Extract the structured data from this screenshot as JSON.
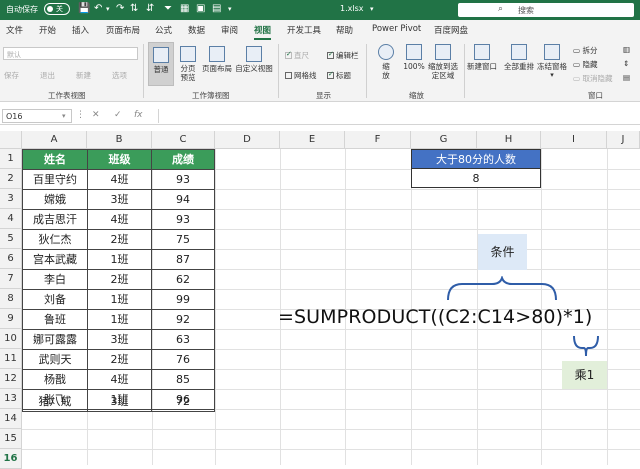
{
  "titlebar": {
    "autosave_label": "自动保存",
    "autosave_state": "关",
    "filename": "1.xlsx",
    "search_placeholder": "搜索",
    "accent": "#217346"
  },
  "tabs": [
    "文件",
    "开始",
    "插入",
    "页面布局",
    "公式",
    "数据",
    "审阅",
    "视图",
    "开发工具",
    "帮助",
    "Power Pivot",
    "百度网盘"
  ],
  "active_tab": "视图",
  "ribbon": {
    "sheetview": {
      "dropdown": "默认",
      "keep": "保存",
      "exit": "退出",
      "new": "新建",
      "options": "选项",
      "label": "工作表视图"
    },
    "workbookview": {
      "normal": "普通",
      "pagebreak": "分页预览",
      "pagelayout": "页面布局",
      "custom": "自定义视图",
      "label": "工作簿视图"
    },
    "show": {
      "ruler": "直尺",
      "formulabar": "编辑栏",
      "gridlines": "网格线",
      "headings": "标题",
      "label": "显示"
    },
    "zoom": {
      "zoom": "缩放",
      "hundred": "100%",
      "toselection": "缩放到选定区域",
      "label": "缩放"
    },
    "window": {
      "newwindow": "新建窗口",
      "arrange": "全部重排",
      "freeze": "冻结窗格",
      "split": "拆分",
      "hide": "隐藏",
      "unhide": "取消隐藏",
      "label": "窗口"
    }
  },
  "formula_bar": {
    "namebox": "O16",
    "fx": "fx"
  },
  "columns": [
    "A",
    "B",
    "C",
    "D",
    "E",
    "F",
    "G",
    "H",
    "I",
    "J"
  ],
  "rows": [
    "1",
    "2",
    "3",
    "4",
    "5",
    "6",
    "7",
    "8",
    "9",
    "10",
    "11",
    "12",
    "13",
    "14",
    "15",
    "16"
  ],
  "table": {
    "headers": [
      "姓名",
      "班级",
      "成绩"
    ],
    "rows": [
      [
        "百里守约",
        "4班",
        "93"
      ],
      [
        "嫦娥",
        "3班",
        "94"
      ],
      [
        "成吉思汗",
        "4班",
        "93"
      ],
      [
        "狄仁杰",
        "2班",
        "75"
      ],
      [
        "宫本武藏",
        "1班",
        "87"
      ],
      [
        "李白",
        "2班",
        "62"
      ],
      [
        "刘备",
        "1班",
        "99"
      ],
      [
        "鲁班",
        "1班",
        "92"
      ],
      [
        "娜可露露",
        "3班",
        "63"
      ],
      [
        "武则天",
        "2班",
        "76"
      ],
      [
        "杨戬",
        "4班",
        "85"
      ],
      [
        "张飞",
        "1班",
        "96"
      ],
      [
        "猪八戒",
        "3班",
        "72"
      ]
    ]
  },
  "summary": {
    "header": "大于80分的人数",
    "value": "8"
  },
  "annotation": {
    "condition": "条件",
    "formula": "=SUMPRODUCT((C2:C14>80)*1)",
    "multiply": "乘1"
  }
}
